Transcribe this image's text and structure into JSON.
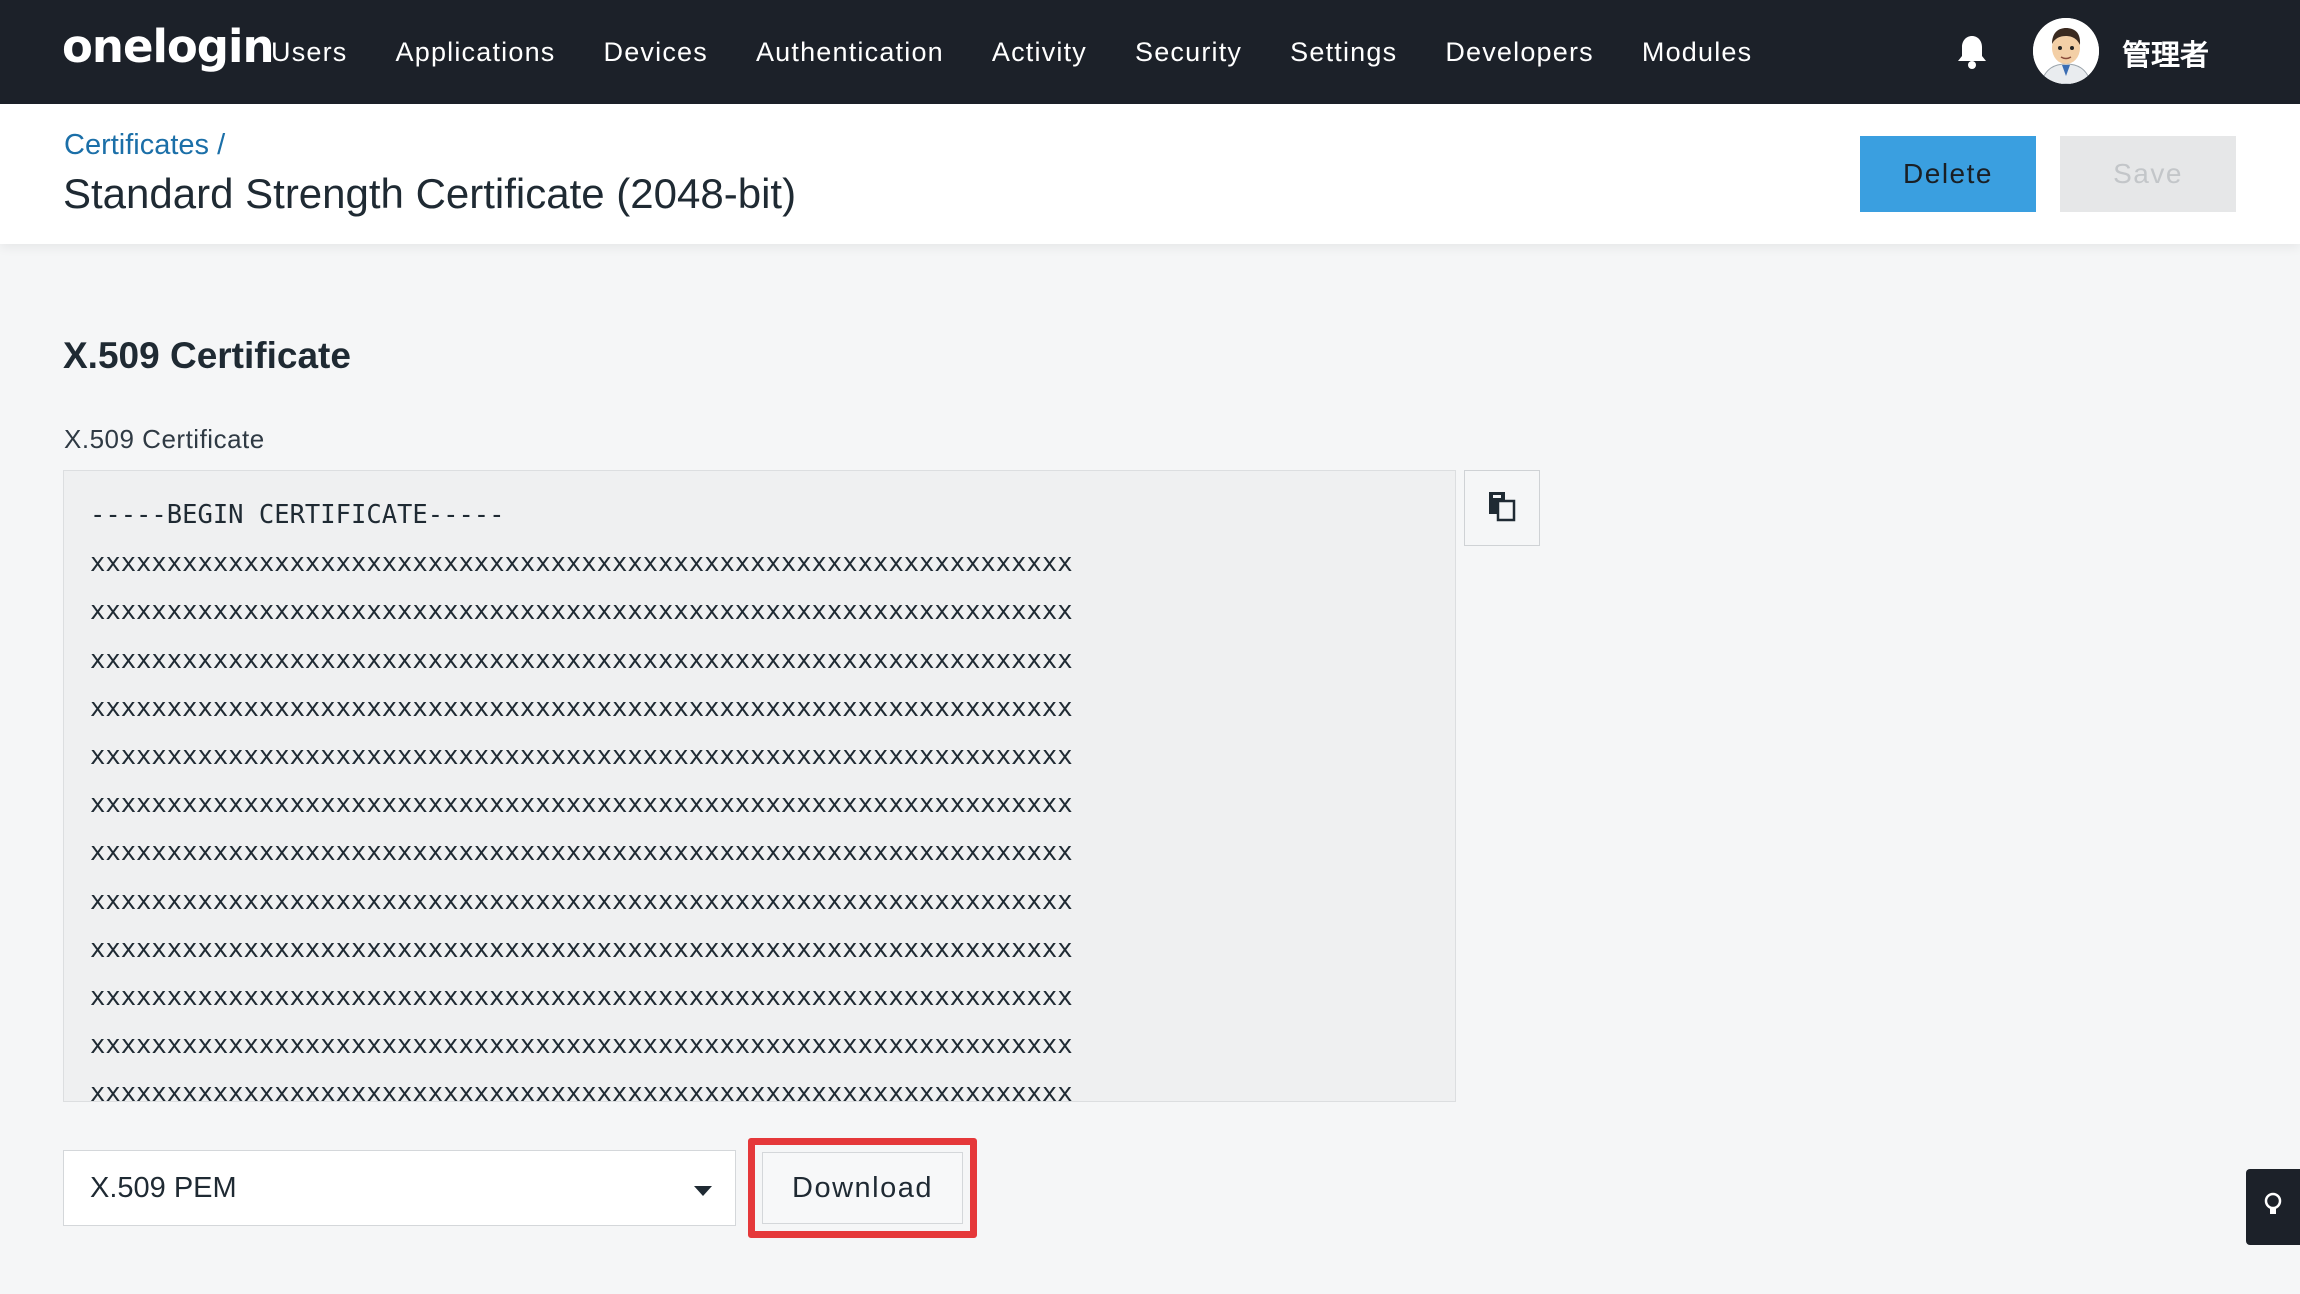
{
  "nav": {
    "logo": "onelogin",
    "items": [
      {
        "label": "Users"
      },
      {
        "label": "Applications"
      },
      {
        "label": "Devices"
      },
      {
        "label": "Authentication"
      },
      {
        "label": "Activity"
      },
      {
        "label": "Security"
      },
      {
        "label": "Settings"
      },
      {
        "label": "Developers"
      },
      {
        "label": "Modules"
      }
    ],
    "bell_icon": "bell-icon",
    "username": "管理者"
  },
  "header": {
    "breadcrumb": "Certificates /",
    "title": "Standard Strength Certificate (2048-bit)",
    "delete_label": "Delete",
    "save_label": "Save"
  },
  "section": {
    "title": "X.509 Certificate",
    "field_label": "X.509 Certificate"
  },
  "certificate": {
    "lines": [
      "-----BEGIN CERTIFICATE-----",
      "xxxxxxxxxxxxxxxxxxxxxxxxxxxxxxxxxxxxxxxxxxxxxxxxxxxxxxxxxxxxxxxx",
      "xxxxxxxxxxxxxxxxxxxxxxxxxxxxxxxxxxxxxxxxxxxxxxxxxxxxxxxxxxxxxxxx",
      "xxxxxxxxxxxxxxxxxxxxxxxxxxxxxxxxxxxxxxxxxxxxxxxxxxxxxxxxxxxxxxxx",
      "xxxxxxxxxxxxxxxxxxxxxxxxxxxxxxxxxxxxxxxxxxxxxxxxxxxxxxxxxxxxxxxx",
      "xxxxxxxxxxxxxxxxxxxxxxxxxxxxxxxxxxxxxxxxxxxxxxxxxxxxxxxxxxxxxxxx",
      "xxxxxxxxxxxxxxxxxxxxxxxxxxxxxxxxxxxxxxxxxxxxxxxxxxxxxxxxxxxxxxxx",
      "xxxxxxxxxxxxxxxxxxxxxxxxxxxxxxxxxxxxxxxxxxxxxxxxxxxxxxxxxxxxxxxx",
      "xxxxxxxxxxxxxxxxxxxxxxxxxxxxxxxxxxxxxxxxxxxxxxxxxxxxxxxxxxxxxxxx",
      "xxxxxxxxxxxxxxxxxxxxxxxxxxxxxxxxxxxxxxxxxxxxxxxxxxxxxxxxxxxxxxxx",
      "xxxxxxxxxxxxxxxxxxxxxxxxxxxxxxxxxxxxxxxxxxxxxxxxxxxxxxxxxxxxxxxx",
      "xxxxxxxxxxxxxxxxxxxxxxxxxxxxxxxxxxxxxxxxxxxxxxxxxxxxxxxxxxxxxxxx",
      "xxxxxxxxxxxxxxxxxxxxxxxxxxxxxxxxxxxxxxxxxxxxxxxxxxxxxxxxxxxxxxxx"
    ],
    "copy_icon": "copy-icon"
  },
  "download": {
    "format_selected": "X.509 PEM",
    "button_label": "Download",
    "highlight_color": "#e5383a"
  },
  "colors": {
    "nav_bg": "#1c2129",
    "primary": "#3a9fe0",
    "link": "#1b6fa8"
  },
  "hint_icon": "lightbulb-icon"
}
